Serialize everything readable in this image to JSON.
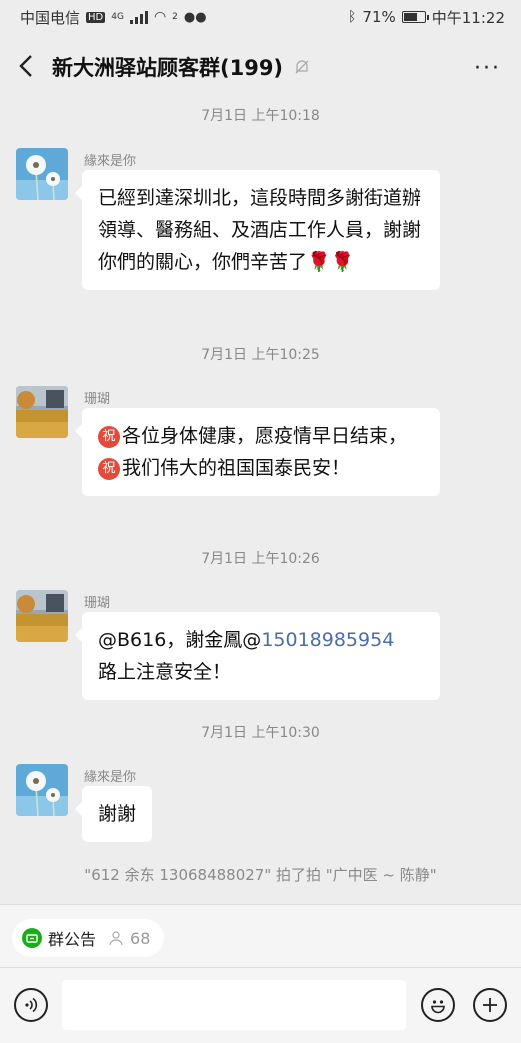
{
  "status_bar": {
    "carrier": "中国电信",
    "network_badge": "HD",
    "network_gen": "4G",
    "wifi_label": "2",
    "battery": "71%",
    "battery_level": 0.71,
    "time": "中午11:22"
  },
  "header": {
    "title": "新大洲驿站顾客群(199)",
    "back_icon": "chevron-left-icon",
    "mute_icon": "bell-muted-icon",
    "more_label": "···"
  },
  "messages": [
    {
      "timestamp": "7月1日 上午10:18",
      "sender": "緣來是你",
      "avatar": "dandelion-avatar",
      "text": "已經到達深圳北，這段時間多謝街道辦領導、醫務組、及酒店工作人員，謝謝你們的關心，你們辛苦了🌹🌹"
    },
    {
      "timestamp": "7月1日 上午10:25",
      "sender": "珊瑚",
      "avatar": "autumn-field-avatar",
      "blessing": "祝",
      "text_part1": "各位身体健康，愿疫情早日结束，",
      "text_part2": "我们伟大的祖国国泰民安！"
    },
    {
      "timestamp": "7月1日 上午10:26",
      "sender": "珊瑚",
      "avatar": "autumn-field-avatar",
      "text_prefix": "@B616，謝金鳳@",
      "phone": "15018985954",
      "text_suffix": "路上注意安全！"
    },
    {
      "timestamp": "7月1日 上午10:30",
      "sender": "緣來是你",
      "avatar": "dandelion-avatar",
      "text": "謝謝"
    }
  ],
  "system_message": "\"612 余东 13068488027\" 拍了拍 \"广中医 ~ 陈静\"",
  "bottom": {
    "notice_label": "群公告",
    "notice_count": "68",
    "voice_icon": "voice-icon",
    "emoji_icon": "emoji-icon",
    "plus_icon": "plus-icon"
  }
}
